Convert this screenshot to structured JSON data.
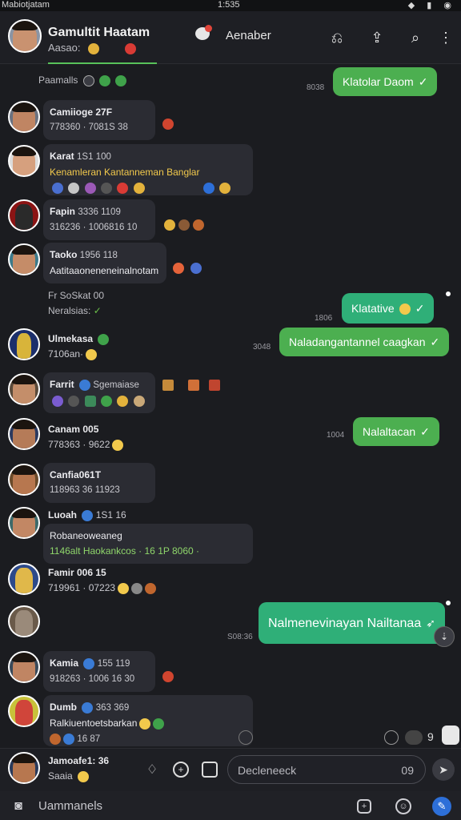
{
  "status_bar": {
    "left": "Mabiotjatam",
    "center": "1:535",
    "right": "◆ ▮ ◉"
  },
  "header": {
    "title": "Gamultit Haatam",
    "subtitle": "Aasao:",
    "center_label": "Aenaber",
    "icons": [
      "chat-bubble-icon",
      "reply-icon",
      "share-icon",
      "search-icon",
      "more-icon"
    ]
  },
  "messages": [
    {
      "kind": "system",
      "text": "Paamalls"
    },
    {
      "kind": "out",
      "text": "Klatolar Daom",
      "time": "8038"
    },
    {
      "kind": "in",
      "name": "Camiioge 27F",
      "meta": "778360 · 7081S 38"
    },
    {
      "kind": "in",
      "name": "Karat",
      "name_meta": "1S1 100",
      "body": "Kenamleran Kantanneman Banglar"
    },
    {
      "kind": "in",
      "name": "Fapin",
      "name_meta": "3336 1109",
      "meta": "316236 · 1006816 10"
    },
    {
      "kind": "in",
      "name": "Taoko",
      "name_meta": "1956 118",
      "body": "Aatitaaoneneneinalnotam"
    },
    {
      "kind": "system",
      "text": "Fr SoSkat 00",
      "sub": "Neralsias:"
    },
    {
      "kind": "out",
      "text": "Klatative",
      "time": "1806"
    },
    {
      "kind": "out",
      "text": "Naladangantannel caagkan",
      "time": "3048"
    },
    {
      "kind": "in",
      "name": "Ulmekasa",
      "meta": "7106an·"
    },
    {
      "kind": "in",
      "name": "Farrit",
      "name_meta": "Sgemaiase"
    },
    {
      "kind": "in",
      "name": "Canam 005",
      "meta": "778363 · 9622"
    },
    {
      "kind": "out",
      "text": "Nalaltacan",
      "time": "1004"
    },
    {
      "kind": "in",
      "name": "Canfia061T",
      "meta": "118963 36 11923"
    },
    {
      "kind": "in",
      "name": "Luoah",
      "name_meta": "1S1 16",
      "body": "Robaneoweaneg",
      "body2": "1146alt Haokankcos · 16 1P 8060 ·"
    },
    {
      "kind": "in",
      "name": "Famir 006 15",
      "meta": "719961 · 07223"
    },
    {
      "kind": "out",
      "text": "Nalmenevinayan Nailtanaa",
      "time": "S08:36"
    },
    {
      "kind": "in",
      "name": "Kamia",
      "name_meta": "155 119",
      "meta": "918263 · 1006 16 30"
    },
    {
      "kind": "in",
      "name": "Dumb",
      "name_meta": "363 369",
      "body": "Ralkiuentoetsbarkan",
      "meta": "16 87"
    }
  ],
  "composer": {
    "name": "Jamoafe1: 36",
    "sub": "Saaia",
    "placeholder": "Decleneeck",
    "count": "09"
  },
  "bottom_bar": {
    "label": "Uammanels"
  },
  "colors": {
    "bg": "#1b1c20",
    "incoming": "#2b2c33",
    "outgoing": "#4caf50",
    "outgoing_alt": "#2faf78",
    "accent": "#58c25a"
  }
}
